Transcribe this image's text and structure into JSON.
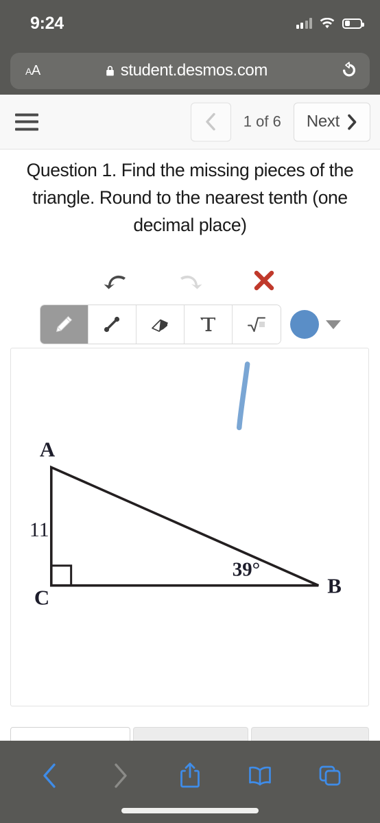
{
  "status_bar": {
    "time": "9:24",
    "icons": [
      "cellular-signal-icon",
      "wifi-icon",
      "battery-icon"
    ],
    "battery_level_pct": 35,
    "background_color": "#585855"
  },
  "browser": {
    "text_size_label": "AA",
    "lock_icon": "lock-icon",
    "url": "student.desmos.com",
    "reload_icon": "reload-icon",
    "bottom_toolbar": {
      "back_icon": "chevron-left-icon",
      "forward_icon": "chevron-right-icon",
      "share_icon": "share-icon",
      "bookmarks_icon": "book-icon",
      "tabs_icon": "tabs-icon",
      "back_enabled": true,
      "forward_enabled": false
    }
  },
  "nav": {
    "menu_icon": "hamburger-menu-icon",
    "prev_icon": "chevron-left-icon",
    "page_indicator": "1 of 6",
    "next_label": "Next",
    "next_icon": "chevron-right-icon"
  },
  "question": {
    "text": "Question 1. Find the missing pieces of the triangle. Round to the nearest tenth (one decimal place)"
  },
  "sketch_toolbar": {
    "actions": [
      {
        "name": "undo",
        "icon": "undo-arrow-icon",
        "enabled": true
      },
      {
        "name": "redo",
        "icon": "redo-arrow-icon",
        "enabled": false
      },
      {
        "name": "clear",
        "icon": "red-x-icon",
        "enabled": true,
        "color": "#c0392b"
      }
    ],
    "tools": [
      {
        "name": "pencil",
        "icon": "pencil-icon",
        "label": "",
        "selected": true
      },
      {
        "name": "line",
        "icon": "line-segment-icon",
        "label": "",
        "selected": false
      },
      {
        "name": "eraser",
        "icon": "eraser-icon",
        "label": "",
        "selected": false
      },
      {
        "name": "text",
        "icon": "text-t-icon",
        "label": "T",
        "selected": false
      },
      {
        "name": "math",
        "icon": "square-root-icon",
        "label": "",
        "selected": false
      }
    ],
    "color": {
      "selected_hex": "#5a8ec7",
      "dropdown_icon": "chevron-down-icon"
    },
    "selected_tool_bg": "#9a9a9a"
  },
  "canvas": {
    "diagram": {
      "type": "right-triangle",
      "vertices": {
        "A": "A",
        "B": "B",
        "C": "C"
      },
      "side_label_AC": "11",
      "angle_label_B": "39°",
      "right_angle_at": "C",
      "stroke_color": "#231f20"
    },
    "user_stroke": {
      "name": "blue-pen-stroke",
      "color": "#6f9ed0"
    }
  },
  "answers": {
    "fields": [
      {
        "name": "answer-field-1",
        "value": "",
        "placeholder": "",
        "focused": true
      },
      {
        "name": "answer-field-2",
        "value": "",
        "placeholder": "",
        "focused": false
      },
      {
        "name": "answer-field-3",
        "value": "",
        "placeholder": "",
        "focused": false
      }
    ]
  }
}
